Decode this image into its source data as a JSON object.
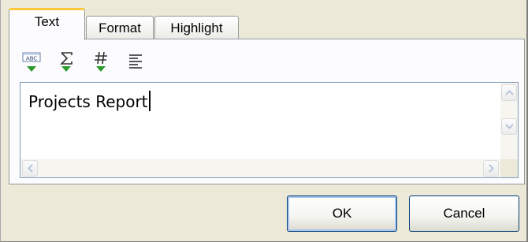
{
  "tabs": [
    {
      "label": "Text",
      "active": true
    },
    {
      "label": "Format",
      "active": false
    },
    {
      "label": "Highlight",
      "active": false
    }
  ],
  "toolbar": {
    "tools": [
      {
        "name": "spell-check-icon",
        "glyph": "ABC"
      },
      {
        "name": "sum-icon",
        "glyph": "Σ"
      },
      {
        "name": "number-icon",
        "glyph": "#"
      },
      {
        "name": "align-left-icon",
        "glyph": ""
      }
    ]
  },
  "editor": {
    "value": "Projects Report"
  },
  "buttons": {
    "ok_label": "OK",
    "cancel_label": "Cancel"
  },
  "colors": {
    "active_tab_accent": "#ffc83c",
    "dropdown_arrow": "#2e9a2e",
    "dialog_bg": "#ece9d8"
  }
}
